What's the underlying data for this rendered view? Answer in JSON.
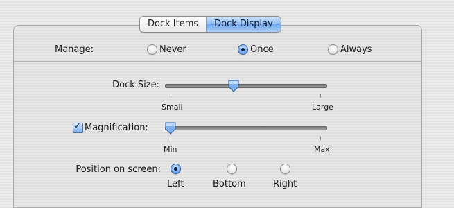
{
  "tabs": {
    "dock_items": "Dock Items",
    "dock_display": "Dock Display",
    "active": "Dock Display"
  },
  "manage": {
    "label": "Manage:",
    "options": [
      "Never",
      "Once",
      "Always"
    ],
    "selected": "Once"
  },
  "dock_size": {
    "label": "Dock Size:",
    "min_label": "Small",
    "max_label": "Large",
    "value": 0.42
  },
  "magnification": {
    "label": "Magnification:",
    "checked": true,
    "min_label": "Min",
    "max_label": "Max",
    "value": 0.0
  },
  "position": {
    "label": "Position on screen:",
    "options": [
      "Left",
      "Bottom",
      "Right"
    ],
    "selected": "Left"
  },
  "colors": {
    "accent": "#6ea7ef",
    "selected_dot": "#0b1d3d"
  }
}
